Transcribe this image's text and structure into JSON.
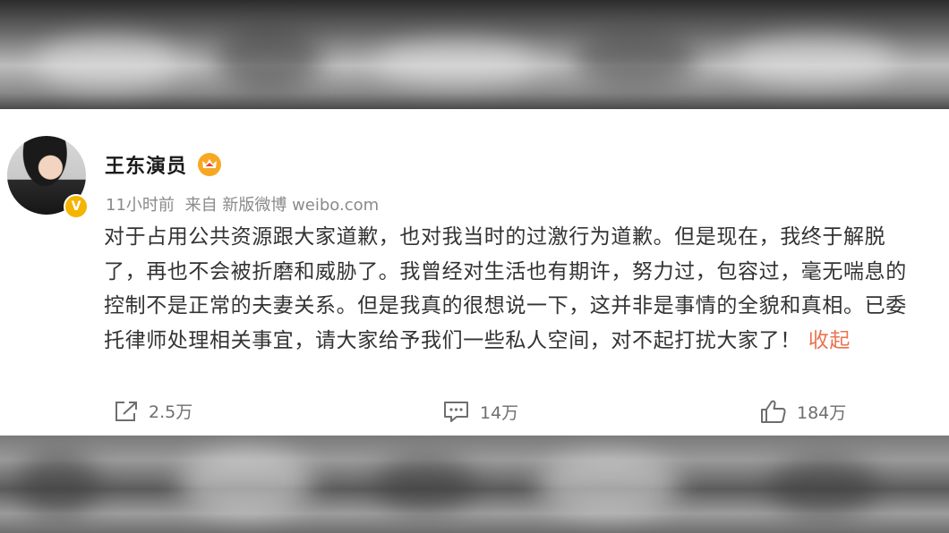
{
  "post": {
    "username": "王东演员",
    "time": "11小时前",
    "source": "来自 新版微博 weibo.com",
    "verified_mark": "V",
    "content_lines": [
      "对于占用公共资源跟大家道歉，也对我当时的过激行为道歉。但是现在，我终于解脱",
      "了，再也不会被折磨和威胁了。我曾经对生活也有期许，努力过，包容过，毫无喘息的",
      "控制不是正常的夫妻关系。但是我真的很想说一下，这并非是事情的全貌和真相。已委",
      "托律师处理相关事宜，请大家给予我们一些私人空间，对不起打扰大家了！"
    ],
    "collapse_label": "收起",
    "actions": {
      "share_count": "2.5万",
      "comment_count": "14万",
      "like_count": "184万"
    },
    "icons": [
      "share-icon",
      "comment-icon",
      "like-icon",
      "crown-icon",
      "verified-icon"
    ],
    "colors": {
      "link": "#eb7350",
      "verified": "#f4b400",
      "crown": "#f7a823"
    }
  }
}
